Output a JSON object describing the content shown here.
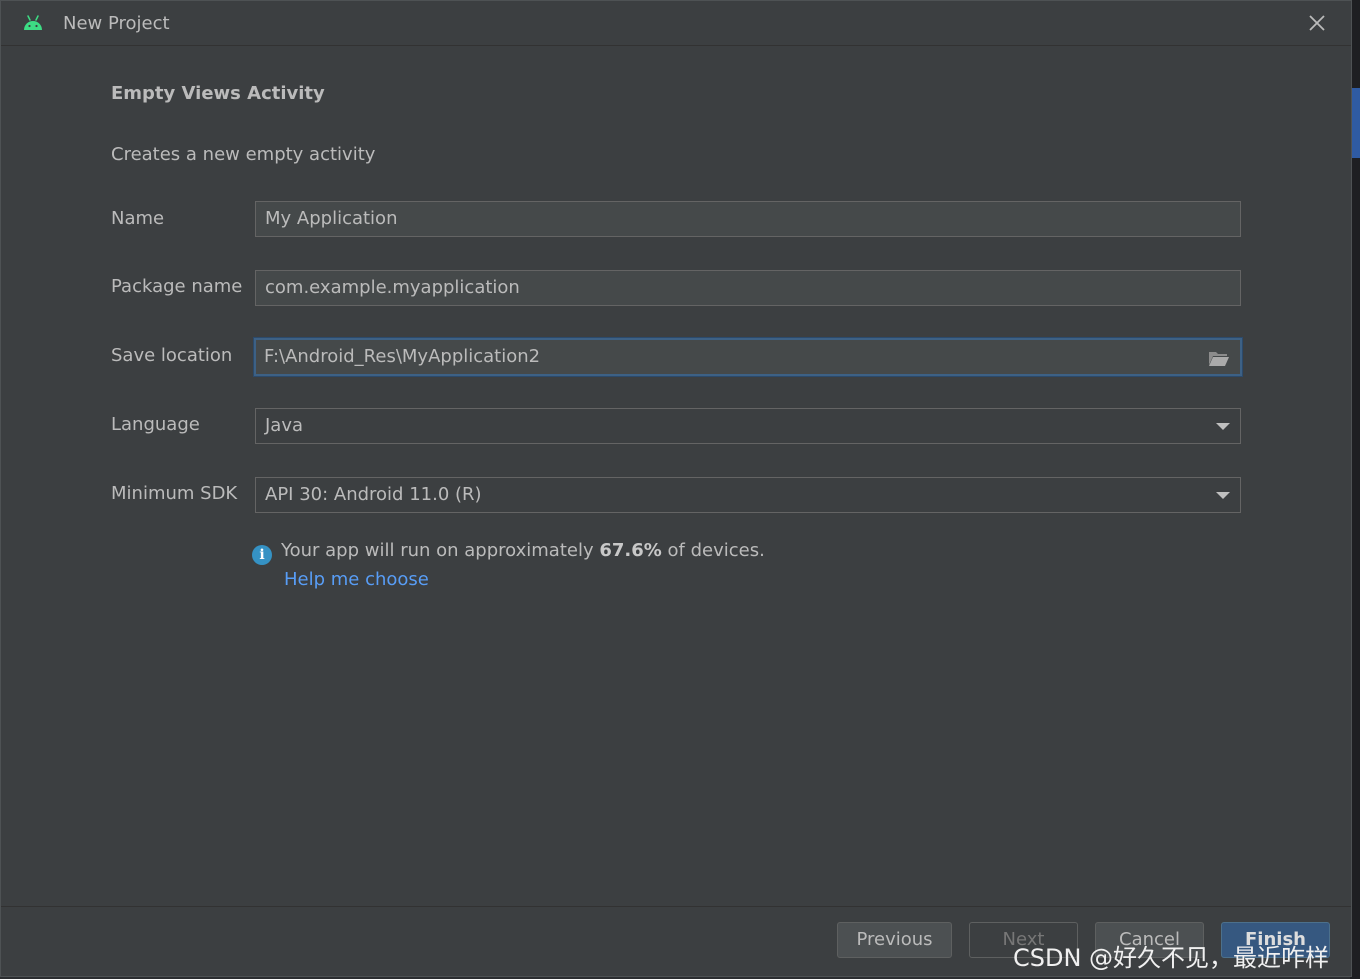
{
  "window": {
    "title": "New Project",
    "close_icon": "close-icon",
    "app_icon": "android-icon"
  },
  "template": {
    "heading": "Empty Views Activity",
    "description": "Creates a new empty activity"
  },
  "form": {
    "name": {
      "label": "Name",
      "value": "My Application"
    },
    "package": {
      "label": "Package name",
      "value": "com.example.myapplication"
    },
    "save_location": {
      "label": "Save location",
      "value": "F:\\Android_Res\\MyApplication2",
      "icon": "folder-icon"
    },
    "language": {
      "label": "Language",
      "value": "Java"
    },
    "min_sdk": {
      "label": "Minimum SDK",
      "value": "API 30: Android 11.0 (R)"
    }
  },
  "info": {
    "prefix": "Your app will run on approximately ",
    "percentage": "67.6%",
    "suffix": " of devices.",
    "link": "Help me choose",
    "icon": "info-icon"
  },
  "buttons": {
    "previous": "Previous",
    "next": "Next",
    "cancel": "Cancel",
    "finish": "Finish"
  },
  "watermark": "CSDN @好久不见，最近咋样",
  "colors": {
    "dialog_bg": "#3c3f41",
    "field_bg": "#45494a",
    "link": "#589df6",
    "accent": "#365880",
    "android_green": "#3ddc84"
  }
}
